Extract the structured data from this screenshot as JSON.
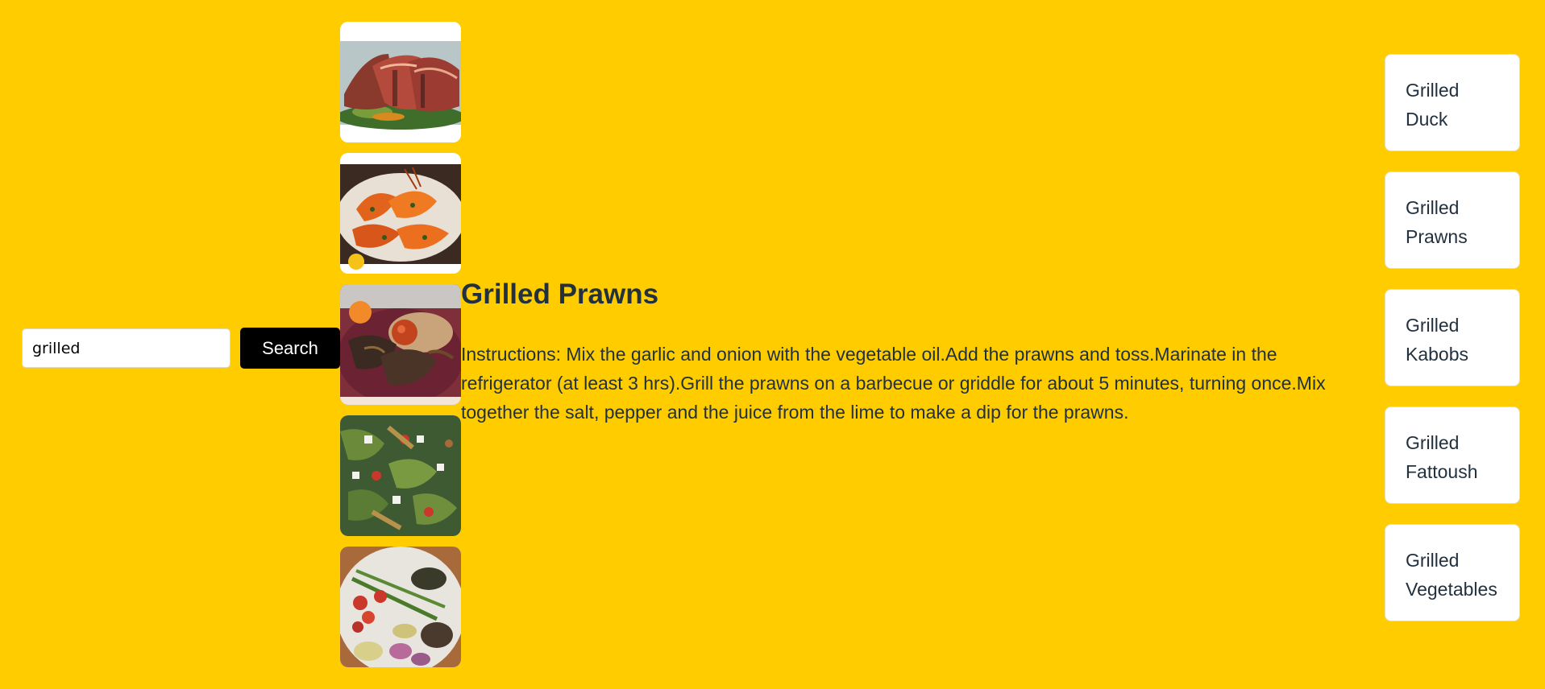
{
  "search": {
    "value": "grilled",
    "button_label": "Search"
  },
  "thumbnails": [
    {
      "icon": "grilled-duck-image"
    },
    {
      "icon": "grilled-prawns-image"
    },
    {
      "icon": "grilled-kabobs-image"
    },
    {
      "icon": "grilled-fattoush-image"
    },
    {
      "icon": "grilled-vegetables-image"
    }
  ],
  "detail": {
    "title": "Grilled Prawns",
    "instructions": "Instructions: Mix the garlic and onion with the vegetable oil.Add the prawns and toss.Marinate in the refrigerator (at least 3 hrs).Grill the prawns on a barbecue or griddle for about 5 minutes, turning once.Mix together the salt, pepper and the juice from the lime to make a dip for the prawns."
  },
  "recipes": [
    {
      "line1": "Grilled",
      "line2": "Duck"
    },
    {
      "line1": "Grilled",
      "line2": "Prawns"
    },
    {
      "line1": "Grilled",
      "line2": "Kabobs"
    },
    {
      "line1": "Grilled",
      "line2": "Fattoush"
    },
    {
      "line1": "Grilled",
      "line2": "Vegetables"
    }
  ],
  "colors": {
    "background": "#FFCC00",
    "text": "#22313f",
    "button": "#000000"
  }
}
